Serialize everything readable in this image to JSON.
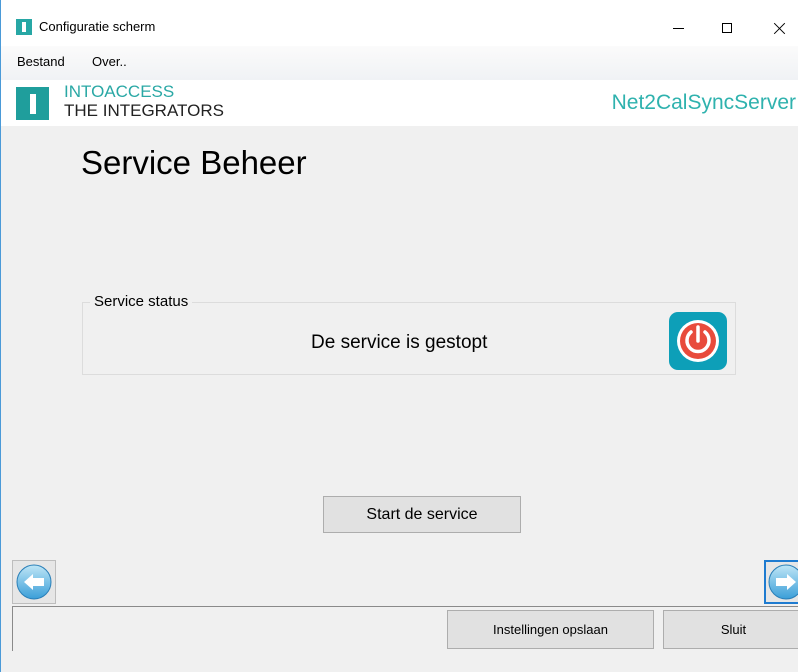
{
  "window": {
    "title": "Configuratie scherm",
    "icon": "app-logo-icon"
  },
  "window_controls": {
    "minimize": "minimize-icon",
    "maximize": "maximize-icon",
    "close": "close-icon"
  },
  "menu": {
    "items": [
      {
        "label": "Bestand"
      },
      {
        "label": "Over.."
      }
    ]
  },
  "banner": {
    "company_line1": "INTOACCESS",
    "company_line2": "THE INTEGRATORS",
    "product": "Net2CalSyncServer",
    "accent_color": "#2aa8a5"
  },
  "main": {
    "title": "Service Beheer",
    "status_group_label": "Service status",
    "status_text": "De service is gestopt",
    "status_icon": "power-stopped-icon",
    "status_icon_color": "#e84b3c",
    "start_button_label": "Start de service"
  },
  "navigation": {
    "back_icon": "arrow-left-icon",
    "forward_icon": "arrow-right-icon"
  },
  "footer": {
    "save_label": "Instellingen opslaan",
    "close_label": "Sluit"
  }
}
